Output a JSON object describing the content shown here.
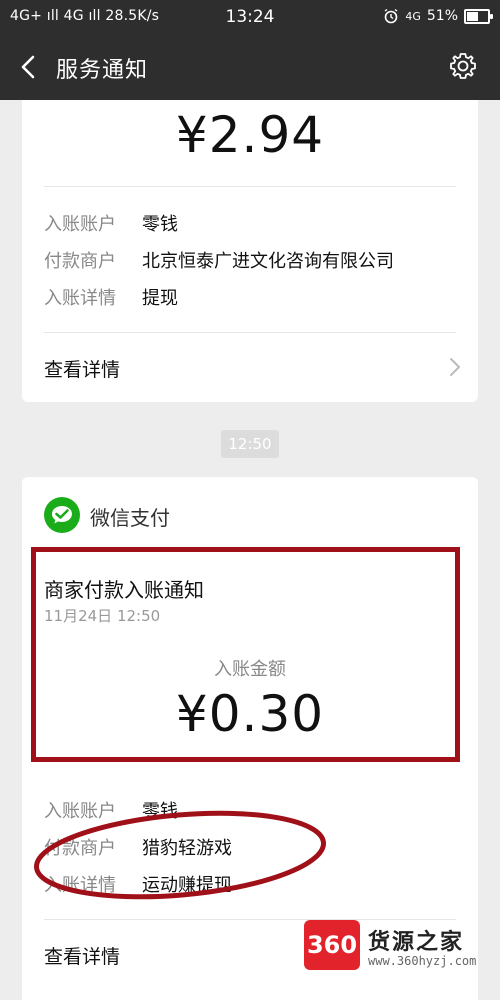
{
  "status_bar": {
    "left": "4G+ ıll 4G ıll 28.5K/s",
    "time": "13:24",
    "network": "4G",
    "battery": "51%",
    "battery_level": 0.51
  },
  "nav": {
    "title": "服务通知"
  },
  "card1": {
    "amount": "¥2.94",
    "rows": [
      {
        "label": "入账账户",
        "value": "零钱"
      },
      {
        "label": "付款商户",
        "value": "北京恒泰广进文化咨询有限公司"
      },
      {
        "label": "入账详情",
        "value": "提现"
      }
    ],
    "details_link": "查看详情"
  },
  "time_divider": "12:50",
  "card2": {
    "app_name": "微信支付",
    "notice_title": "商家付款入账通知",
    "date": "11月24日 12:50",
    "amount_label": "入账金额",
    "amount": "¥0.30",
    "rows": [
      {
        "label": "入账账户",
        "value": "零钱"
      },
      {
        "label": "付款商户",
        "value": "猎豹轻游戏"
      },
      {
        "label": "入账详情",
        "value": "运动赚提现"
      }
    ],
    "details_link": "查看详情"
  },
  "watermark": {
    "badge": "360",
    "name": "货源之家",
    "url": "www.360hyzj.com"
  },
  "colors": {
    "header": "#2e2e2e",
    "background": "#ededed",
    "annotation": "#a01019",
    "wechat_green": "#1aad19"
  }
}
